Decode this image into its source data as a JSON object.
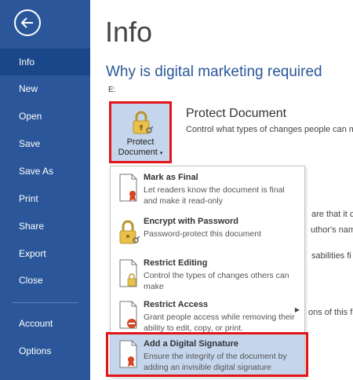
{
  "sidebar": {
    "items": [
      {
        "label": "Info",
        "active": true
      },
      {
        "label": "New"
      },
      {
        "label": "Open"
      },
      {
        "label": "Save"
      },
      {
        "label": "Save As"
      },
      {
        "label": "Print"
      },
      {
        "label": "Share"
      },
      {
        "label": "Export"
      },
      {
        "label": "Close"
      },
      {
        "label": "Account"
      },
      {
        "label": "Options"
      }
    ]
  },
  "main": {
    "page_title": "Info",
    "doc_title": "Why is digital marketing required",
    "doc_path": "E:",
    "protect_button": {
      "line1": "Protect",
      "line2": "Document"
    },
    "section_heading": "Protect Document",
    "section_desc": "Control what types of changes people can m",
    "background_fragments": {
      "line1": "are that it c",
      "line2": "uthor's nam",
      "line3": "sabilities fi",
      "line4": "ons of this fi"
    }
  },
  "protect_menu": {
    "items": [
      {
        "title": "Mark as Final",
        "desc": "Let readers know the document is final and make it read-only"
      },
      {
        "title": "Encrypt with Password",
        "desc": "Password-protect this document"
      },
      {
        "title": "Restrict Editing",
        "desc": "Control the types of changes others can make"
      },
      {
        "title": "Restrict Access",
        "desc": "Grant people access while removing their ability to edit, copy, or print."
      },
      {
        "title": "Add a Digital Signature",
        "desc": "Ensure the integrity of the document by adding an invisible digital signature"
      }
    ]
  },
  "colors": {
    "sidebar_bg": "#2b579a",
    "sidebar_active": "#19478a",
    "accent": "#2b579a",
    "highlight_bg": "#c5d5ec",
    "annotation_red": "#e3141a"
  }
}
